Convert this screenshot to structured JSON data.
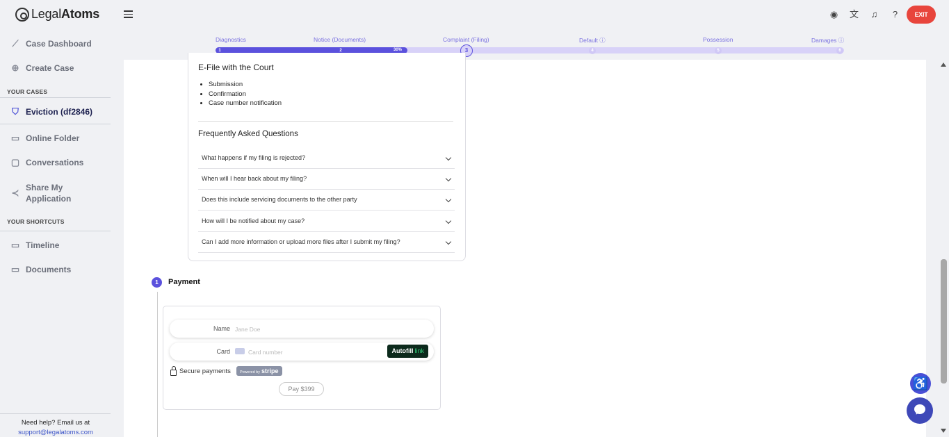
{
  "brand": {
    "logo_plain": "Legal",
    "logo_bold": "Atoms"
  },
  "sidebar": {
    "items_top": [
      {
        "label": "Case Dashboard",
        "icon": "trend-line-icon"
      },
      {
        "label": "Create Case",
        "icon": "plus-circle-icon"
      }
    ],
    "your_cases_label": "YOUR CASES",
    "active_case": {
      "label": "Eviction (df2846)",
      "icon": "shield-icon"
    },
    "items_mid": [
      {
        "label": "Online Folder",
        "icon": "folder-upload-icon"
      },
      {
        "label": "Conversations",
        "icon": "chat-bubble-icon"
      },
      {
        "label_line1": "Share My",
        "label_line2": "Application",
        "icon": "share-icon"
      }
    ],
    "shortcuts_label": "YOUR SHORTCUTS",
    "shortcuts": [
      {
        "label": "Timeline",
        "icon": "folder-icon"
      },
      {
        "label": "Documents",
        "icon": "folder-icon"
      }
    ],
    "help_text": "Need help? Email us at",
    "help_email": "support@legalatoms.com"
  },
  "header": {
    "icons": [
      "user-circle-icon",
      "translate-icon",
      "bell-icon",
      "help-circle-icon"
    ],
    "exit_label": "EXIT"
  },
  "progress": {
    "steps": [
      {
        "label": "Diagnostics",
        "num": "1",
        "state": "done"
      },
      {
        "label": "Notice (Documents)",
        "num": "2",
        "state": "done"
      },
      {
        "label": "Complaint (Filing)",
        "num": "3",
        "state": "current"
      },
      {
        "label": "Default ⓘ",
        "num": "4",
        "state": "todo"
      },
      {
        "label": "Possession",
        "num": "5",
        "state": "todo"
      },
      {
        "label": "Damages ⓘ",
        "num": "6",
        "state": "todo"
      }
    ],
    "percent_label": "30%",
    "percent_value": 30
  },
  "main": {
    "efile_title": "E-File with the Court",
    "efile_bullets": [
      "Submission",
      "Confirmation",
      "Case number notification"
    ],
    "faq_title": "Frequently Asked Questions",
    "faqs": [
      "What happens if my filing is rejected?",
      "When will I hear back about my filing?",
      "Does this include servicing documents to the other party",
      "How will I be notified about my case?",
      "Can I add more information or upload more files after I submit my filing?"
    ],
    "payment": {
      "step_num": "1",
      "title": "Payment",
      "name_label": "Name",
      "name_placeholder": "Jane Doe",
      "card_label": "Card",
      "card_placeholder": "Card number",
      "autofill_label": "Autofill",
      "autofill_link": "link",
      "secure_label": "Secure payments",
      "powered_by": "Powered by",
      "stripe_label": "stripe",
      "pay_label": "Pay $399"
    }
  },
  "colors": {
    "accent": "#5b51dd",
    "exit": "#e8453c",
    "chat": "#3e48b8"
  }
}
